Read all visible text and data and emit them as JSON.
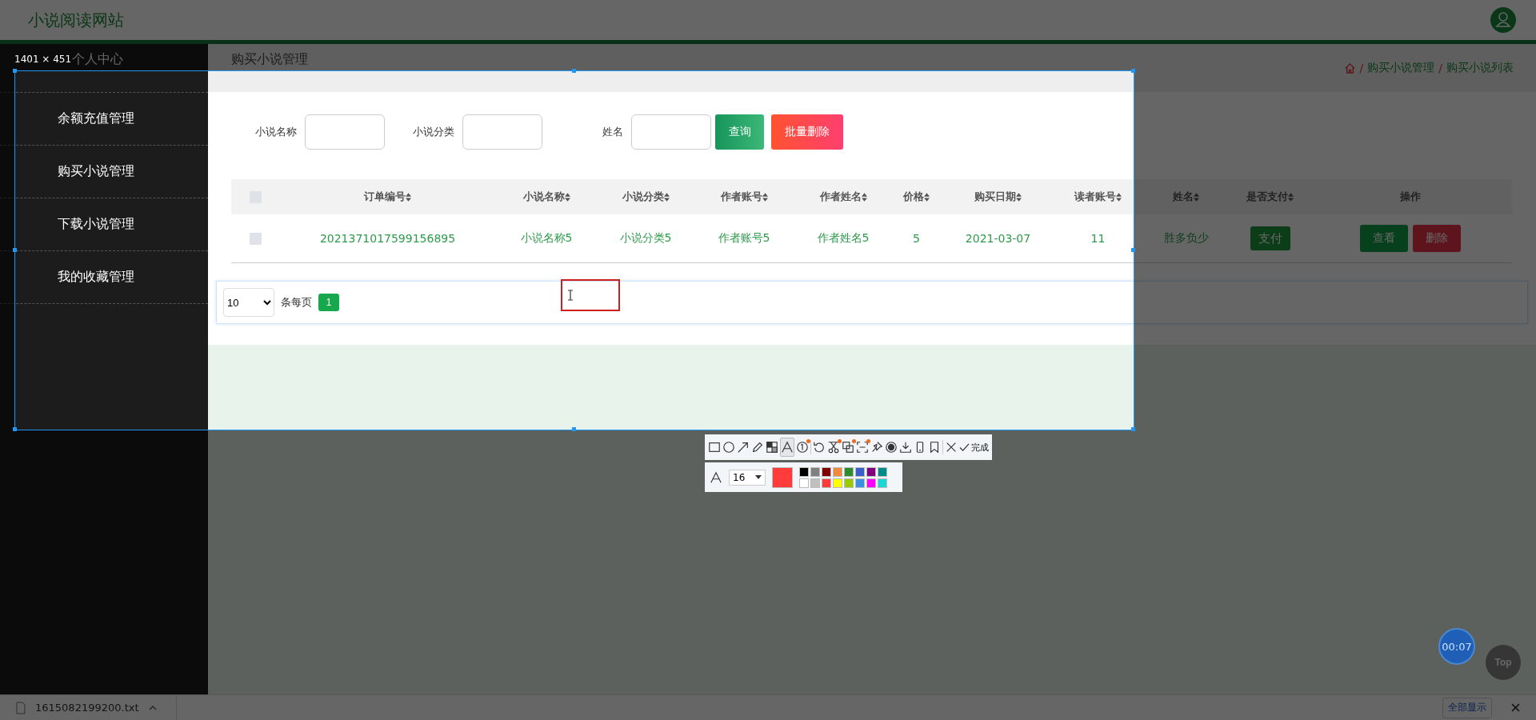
{
  "site_title": "小说阅读网站",
  "sidebar": {
    "items": [
      {
        "label": "个人中心"
      },
      {
        "label": "余额充值管理"
      },
      {
        "label": "购买小说管理"
      },
      {
        "label": "下载小说管理"
      },
      {
        "label": "我的收藏管理"
      }
    ]
  },
  "breadcrumb": {
    "page_title": "购买小说管理",
    "separator": "/",
    "trail": [
      "购买小说管理",
      "购买小说列表"
    ]
  },
  "search": {
    "fields": [
      {
        "label": "小说名称"
      },
      {
        "label": "小说分类"
      },
      {
        "label": "姓名"
      }
    ],
    "query_button": "查询",
    "delete_button": "批量删除"
  },
  "table": {
    "select_all_checked": false,
    "columns": [
      "订单编号",
      "小说名称",
      "小说分类",
      "作者账号",
      "作者姓名",
      "价格",
      "购买日期",
      "读者账号",
      "姓名",
      "是否支付",
      "操作"
    ],
    "rows": [
      {
        "checked": false,
        "cells": [
          "2021371017599156895",
          "小说名称5",
          "小说分类5",
          "作者账号5",
          "作者姓名5",
          "5",
          "2021-03-07",
          "11",
          "胜多负少"
        ],
        "pay_button": "支付",
        "actions": [
          "查看",
          "删除"
        ]
      }
    ]
  },
  "pagination": {
    "page_size": "10",
    "per_page_label": "条每页",
    "pages": [
      {
        "label": "1",
        "selected": true
      }
    ]
  },
  "screenshot_tool": {
    "size_label": "1401 × 451",
    "tools": [
      {
        "kind": "rectangle",
        "selected": false,
        "badge": false
      },
      {
        "kind": "ellipse",
        "selected": false,
        "badge": false
      },
      {
        "kind": "arrow",
        "selected": false,
        "badge": false
      },
      {
        "kind": "pencil",
        "selected": false,
        "badge": false
      },
      {
        "kind": "mosaic",
        "selected": false,
        "badge": false
      },
      {
        "kind": "text",
        "selected": true,
        "badge": false
      },
      {
        "kind": "number",
        "selected": false,
        "badge": true
      },
      {
        "kind": "undo",
        "selected": false,
        "badge": false
      },
      {
        "kind": "scissors",
        "selected": false,
        "badge": true
      },
      {
        "kind": "translate",
        "selected": false,
        "badge": true
      },
      {
        "kind": "recognize",
        "selected": false,
        "badge": true
      },
      {
        "kind": "pin",
        "selected": false,
        "badge": false
      },
      {
        "kind": "record",
        "selected": false,
        "badge": false
      },
      {
        "kind": "download",
        "selected": false,
        "badge": false
      },
      {
        "kind": "phone",
        "selected": false,
        "badge": false
      },
      {
        "kind": "bookmark",
        "selected": false,
        "badge": false
      },
      {
        "kind": "close",
        "selected": false,
        "badge": false
      }
    ],
    "confirm_label": "完成",
    "font_size": "16",
    "current": {
      "color": "#ff3b3b"
    },
    "swatches": [
      {
        "color": "#000000"
      },
      {
        "color": "#808080"
      },
      {
        "color": "#800000"
      },
      {
        "color": "#f08a3c"
      },
      {
        "color": "#2e8b2e"
      },
      {
        "color": "#3a5fcd"
      },
      {
        "color": "#800080"
      },
      {
        "color": "#008b8b"
      },
      {
        "color": "#ffffff"
      },
      {
        "color": "#c0c0c0"
      },
      {
        "color": "#ff3b3b"
      },
      {
        "color": "#ffff00"
      },
      {
        "color": "#99cc00"
      },
      {
        "color": "#3a8fdf"
      },
      {
        "color": "#ff00ff"
      },
      {
        "color": "#1fd6d6"
      }
    ],
    "timer": "00:07"
  },
  "top_button": "Top",
  "download_bar": {
    "file_name": "1615082199200.txt",
    "show_all": "全部显示"
  }
}
